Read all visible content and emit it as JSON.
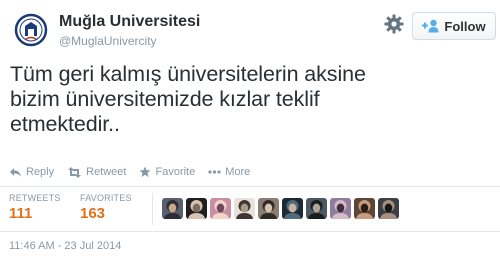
{
  "user": {
    "name": "Muğla Universitesi",
    "handle": "@MuglaUnivercity"
  },
  "follow_button": {
    "label": "Follow"
  },
  "tweet": {
    "text": "Tüm geri kalmış üniversitelerin aksine\nbizim üniversitemizde kızlar teklif\netmektedir.."
  },
  "actions": [
    {
      "label": "Reply",
      "icon": "reply-icon"
    },
    {
      "label": "Retweet",
      "icon": "retweet-icon"
    },
    {
      "label": "Favorite",
      "icon": "star-icon"
    },
    {
      "label": "More",
      "icon": "more-icon"
    }
  ],
  "stats": {
    "retweets_label": "RETWEETS",
    "retweets_value": "111",
    "favorites_label": "FAVORITES",
    "favorites_value": "163"
  },
  "favoriters": [
    {
      "colors": [
        "#5a5f6e",
        "#2b2e35",
        "#c9a58a"
      ]
    },
    {
      "colors": [
        "#1f1f1f",
        "#d9c2b0",
        "#7a6a5e"
      ]
    },
    {
      "colors": [
        "#c98ea3",
        "#f0d5c8",
        "#6e4b5a"
      ]
    },
    {
      "colors": [
        "#e8e2d8",
        "#3d3632",
        "#a89c8c"
      ]
    },
    {
      "colors": [
        "#8b7d71",
        "#2e2a27",
        "#d3c4b4"
      ]
    },
    {
      "colors": [
        "#1e2a33",
        "#4f6b7c",
        "#c8b4a0"
      ]
    },
    {
      "colors": [
        "#4c5963",
        "#1a1d20",
        "#b0a59a"
      ]
    },
    {
      "colors": [
        "#8d7ea0",
        "#d9b9c2",
        "#3b2f3f"
      ]
    },
    {
      "colors": [
        "#5d4433",
        "#c89d7d",
        "#2a1e18"
      ]
    },
    {
      "colors": [
        "#3c3f44",
        "#a98f7e",
        "#15171a"
      ]
    }
  ],
  "timestamp": "11:46 AM - 23 Jul 2014",
  "colors": {
    "accent": "#e0701a",
    "muted": "#8899a6",
    "follow_icon": "#55acee"
  }
}
